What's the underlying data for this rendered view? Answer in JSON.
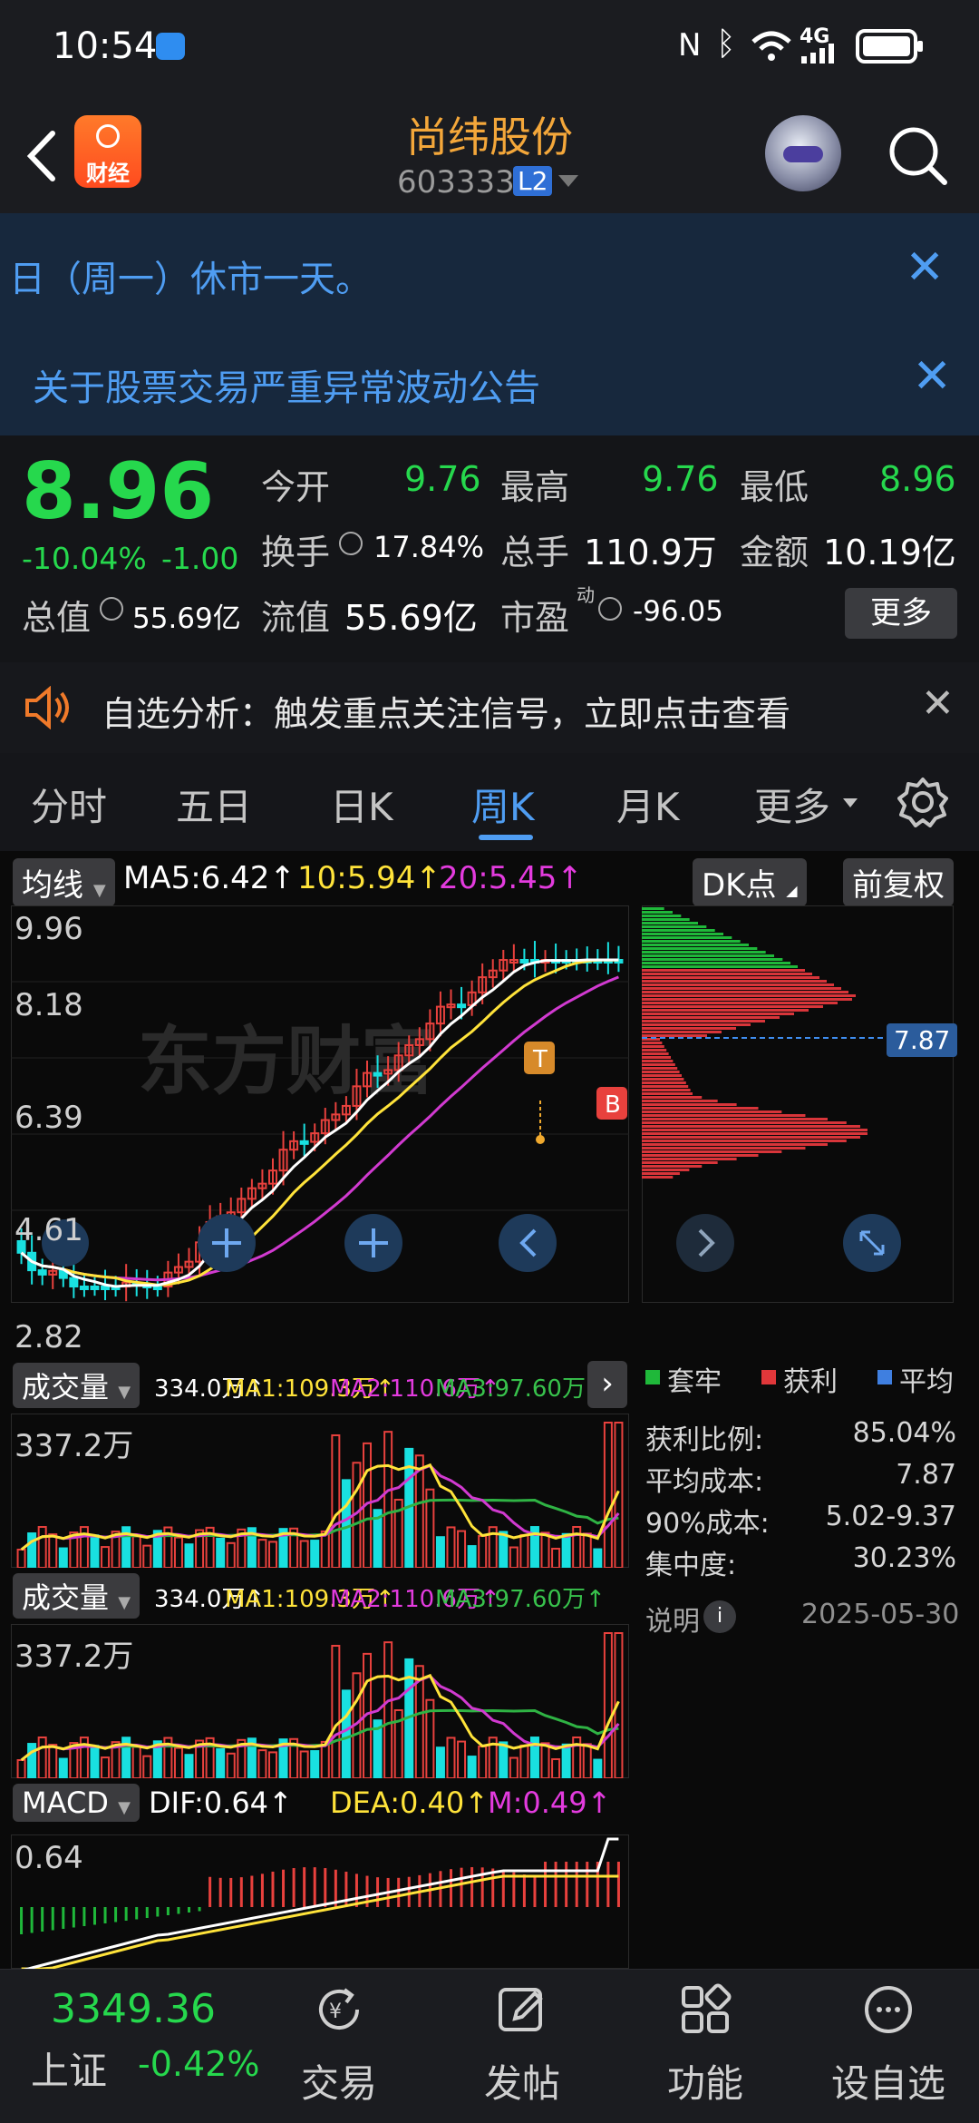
{
  "status_bar": {
    "time": "10:54",
    "network": "4G"
  },
  "header": {
    "title": "尚纬股份",
    "code": "603333",
    "level_badge": "L2",
    "logo_text": "财经"
  },
  "notices": [
    {
      "text": "日（周一）休市一天。"
    },
    {
      "text": "关于股票交易严重异常波动公告"
    }
  ],
  "quote": {
    "price": "8.96",
    "change_pct": "-10.04%",
    "change": "-1.00",
    "open_label": "今开",
    "open": "9.76",
    "high_label": "最高",
    "high": "9.76",
    "low_label": "最低",
    "low": "8.96",
    "turnover_label": "换手",
    "turnover": "17.84%",
    "volume_label": "总手",
    "volume": "110.9万",
    "amount_label": "金额",
    "amount": "10.19亿",
    "mktcap_label": "总值",
    "mktcap": "55.69亿",
    "float_label": "流值",
    "float": "55.69亿",
    "pe_label": "市盈",
    "pe_sup": "动",
    "pe": "-96.05",
    "more_label": "更多"
  },
  "alert": {
    "text": "自选分析：触发重点关注信号，立即点击查看"
  },
  "tabs": [
    "分时",
    "五日",
    "日K",
    "周K",
    "月K",
    "更多"
  ],
  "active_tab": "周K",
  "kline": {
    "indicator_label": "均线",
    "ma5": "MA5:6.42↑",
    "ma10": "10:5.94↑",
    "ma20": "20:5.45↑",
    "dk_label": "DK点",
    "adjust_label": "前复权",
    "y_ticks": [
      "9.96",
      "8.18",
      "6.39",
      "4.61",
      "2.82"
    ],
    "marker_t": "T",
    "marker_b": "B",
    "watermark": "东方财富"
  },
  "chip": {
    "avg_cost_tag": "7.87",
    "legend": [
      "套牢",
      "获利",
      "平均"
    ],
    "rows": [
      {
        "label": "获利比例:",
        "value": "85.04%"
      },
      {
        "label": "平均成本:",
        "value": "7.87"
      },
      {
        "label": "90%成本:",
        "value": "5.02-9.37"
      },
      {
        "label": "集中度:",
        "value": "30.23%"
      }
    ],
    "note_label": "说明",
    "date": "2025-05-30"
  },
  "volume_panels": [
    {
      "label": "成交量",
      "vol": "334.0万↑",
      "ma1": "MA1:109.3万↑",
      "ma2": "MA2:110.6万↑",
      "ma3": "MA3:97.60万↑",
      "y_max": "337.2万"
    },
    {
      "label": "成交量",
      "vol": "334.0万↑",
      "ma1": "MA1:109.3万↑",
      "ma2": "MA2:110.6万↑",
      "ma3": "MA3:97.60万↑",
      "y_max": "337.2万"
    }
  ],
  "macd": {
    "label": "MACD",
    "dif": "DIF:0.64↑",
    "dea": "DEA:0.40↑",
    "m": "M:0.49↑",
    "y_max": "0.64"
  },
  "bottom": {
    "index_value": "3349.36",
    "index_name": "上证",
    "index_change": "-0.42%",
    "items": [
      "交易",
      "发帖",
      "功能",
      "设自选"
    ]
  },
  "colors": {
    "up": "#e8413d",
    "down": "#26d84d",
    "accent": "#f0a92e",
    "link": "#4f9df2",
    "tab_active": "#4f9df2"
  }
}
